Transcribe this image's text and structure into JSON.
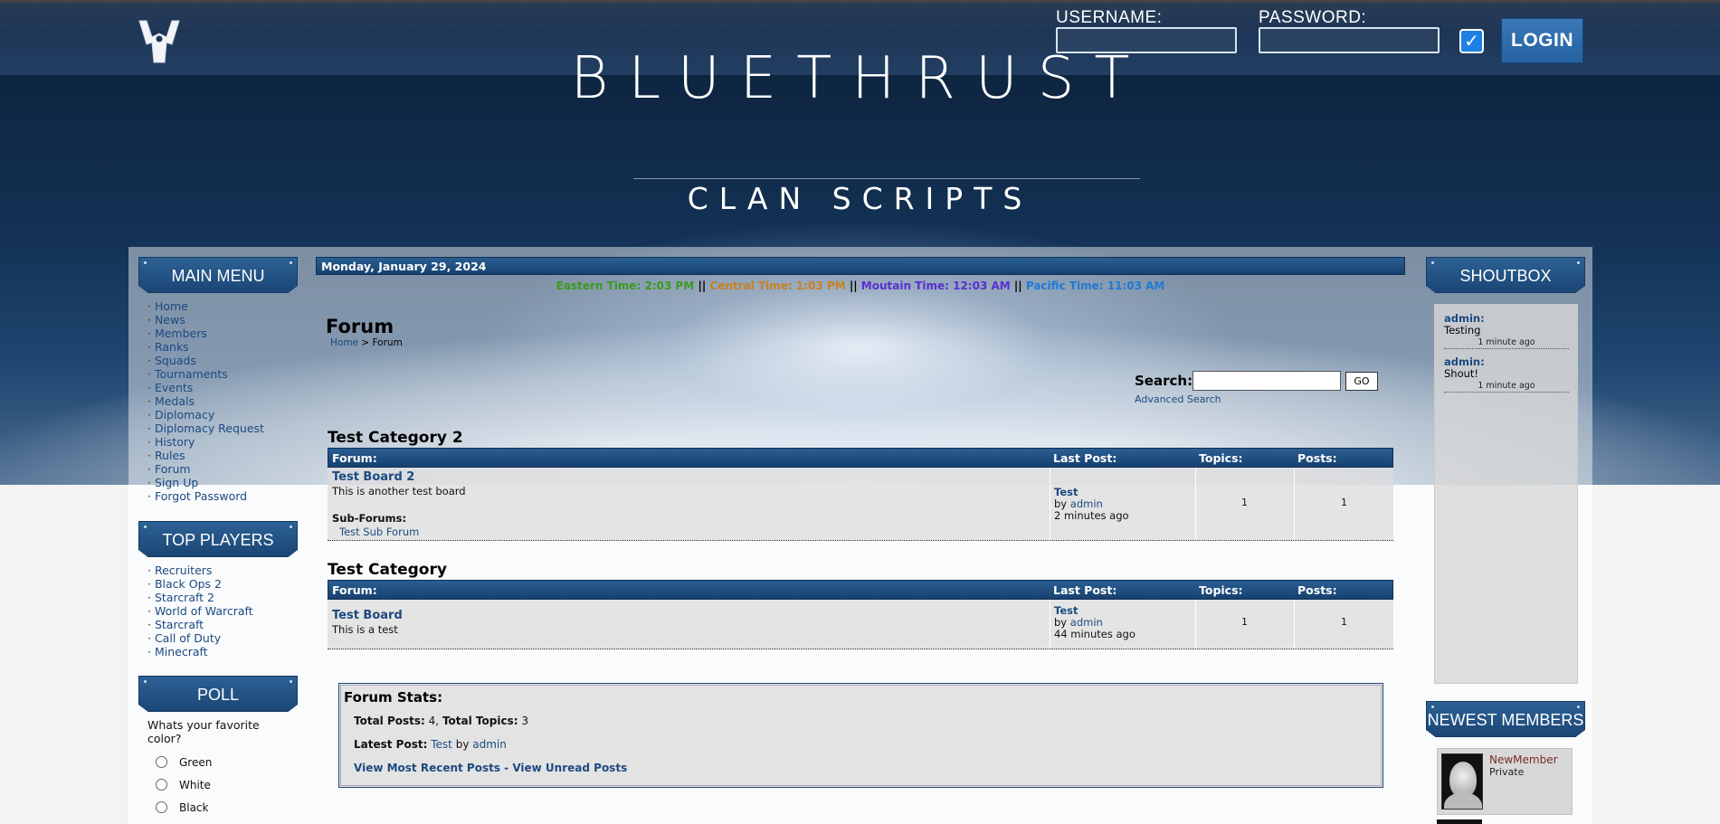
{
  "header": {
    "username_label": "USERNAME:",
    "password_label": "PASSWORD:",
    "login_label": "LOGIN",
    "remember_checked": true
  },
  "banner": {
    "title": "BLUETHRUST",
    "subtitle": "CLAN SCRIPTS"
  },
  "left": {
    "main_menu_title": "MAIN MENU",
    "main_menu": [
      "Home",
      "News",
      "Members",
      "Ranks",
      "Squads",
      "Tournaments",
      "Events",
      "Medals",
      "Diplomacy",
      "Diplomacy Request",
      "History",
      "Rules",
      "Forum",
      "Sign Up",
      "Forgot Password"
    ],
    "top_players_title": "TOP PLAYERS",
    "top_players": [
      "Recruiters",
      "Black Ops 2",
      "Starcraft 2",
      "World of Warcraft",
      "Starcraft",
      "Call of Duty",
      "Minecraft"
    ],
    "poll_title": "POLL",
    "poll_question": "Whats your favorite color?",
    "poll_options": [
      "Green",
      "White",
      "Black"
    ]
  },
  "center": {
    "date": "Monday, January 29, 2024",
    "times": {
      "eastern": "Eastern Time: 2:03 PM",
      "central": "Central Time: 1:03 PM",
      "mountain": "Moutain Time: 12:03 AM",
      "pacific": "Pacific Time: 11:03 AM",
      "separator": "||"
    },
    "page_title": "Forum",
    "breadcrumb": {
      "home": "Home",
      "sep": ">",
      "current": "Forum"
    },
    "search": {
      "label": "Search:",
      "go": "GO",
      "advanced": "Advanced Search",
      "value": ""
    },
    "table_headers": {
      "forum": "Forum:",
      "last_post": "Last Post:",
      "topics": "Topics:",
      "posts": "Posts:"
    },
    "categories": [
      {
        "title": "Test Category 2",
        "boards": [
          {
            "name": "Test Board 2",
            "description": "This is another test board",
            "subforums_label": "Sub-Forums:",
            "subforum": "Test Sub Forum",
            "last_post_title": "Test",
            "last_post_by": "by",
            "last_post_user": "admin",
            "last_post_time": "2 minutes ago",
            "topics": "1",
            "posts": "1"
          }
        ]
      },
      {
        "title": "Test Category",
        "boards": [
          {
            "name": "Test Board",
            "description": "This is a test",
            "last_post_title": "Test",
            "last_post_by": "by",
            "last_post_user": "admin",
            "last_post_time": "44 minutes ago",
            "topics": "1",
            "posts": "1"
          }
        ]
      }
    ],
    "stats": {
      "title": "Forum Stats:",
      "total_posts_label": "Total Posts:",
      "total_posts": "4",
      "total_topics_label": "Total Topics:",
      "total_topics": "3",
      "latest_post_label": "Latest Post:",
      "latest_post_title": "Test",
      "latest_post_by": "by",
      "latest_post_user": "admin",
      "recent_link": "View Most Recent Posts",
      "link_sep": "-",
      "unread_link": "View Unread Posts"
    }
  },
  "right": {
    "shoutbox_title": "SHOUTBOX",
    "shouts": [
      {
        "user": "admin:",
        "message": "Testing",
        "time": "1 minute ago"
      },
      {
        "user": "admin:",
        "message": "Shout!",
        "time": "1 minute ago"
      }
    ],
    "newest_members_title": "NEWEST MEMBERS",
    "newest_member": {
      "name": "NewMember",
      "rank": "Private"
    }
  },
  "colors": {
    "eastern": "#3a9a1e",
    "central": "#c9811e",
    "mountain": "#5a2fd0",
    "pacific": "#1e7ad8",
    "header_blue": "#1b4675",
    "link": "#1c4a80"
  }
}
